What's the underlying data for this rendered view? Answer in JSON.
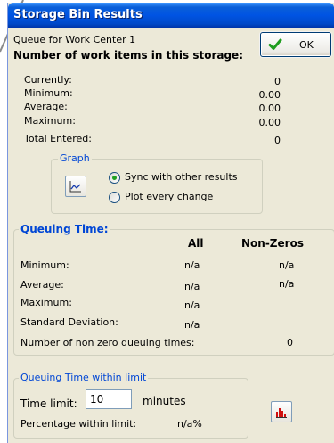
{
  "window": {
    "title": "Storage Bin Results"
  },
  "header": {
    "queue_name": "Queue for Work Center 1",
    "heading": "Number of work items in this storage:"
  },
  "ok_button": {
    "label": "OK"
  },
  "storage_stats": [
    {
      "label": "Currently:",
      "value": "0"
    },
    {
      "label": "Minimum:",
      "value": "0.00"
    },
    {
      "label": "Average:",
      "value": "0.00"
    },
    {
      "label": "Maximum:",
      "value": "0.00"
    },
    {
      "label": "Total Entered:",
      "value": "0"
    }
  ],
  "graph": {
    "legend": "Graph",
    "options": [
      {
        "label": "Sync with other results",
        "selected": true
      },
      {
        "label": "Plot every change",
        "selected": false
      }
    ]
  },
  "queuing_time": {
    "legend": "Queuing Time:",
    "col_all": "All",
    "col_nonzeros": "Non-Zeros",
    "rows": [
      {
        "label": "Minimum:",
        "all": "n/a",
        "nonzeros": "n/a"
      },
      {
        "label": "Average:",
        "all": "n/a",
        "nonzeros": "n/a"
      },
      {
        "label": "Maximum:",
        "all": "n/a",
        "nonzeros": ""
      },
      {
        "label": "Standard Deviation:",
        "all": "n/a",
        "nonzeros": ""
      }
    ],
    "nonzero_count_label": "Number of non zero queuing times:",
    "nonzero_count_value": "0"
  },
  "limit": {
    "legend": "Queuing Time within limit",
    "time_limit_label": "Time limit:",
    "time_limit_value": "10",
    "unit": "minutes",
    "pct_label": "Percentage within limit:",
    "pct_value": "n/a%"
  },
  "colors": {
    "titlebar": "#0054e3",
    "legend_text": "#0046d5",
    "window_bg": "#ece9d8"
  }
}
